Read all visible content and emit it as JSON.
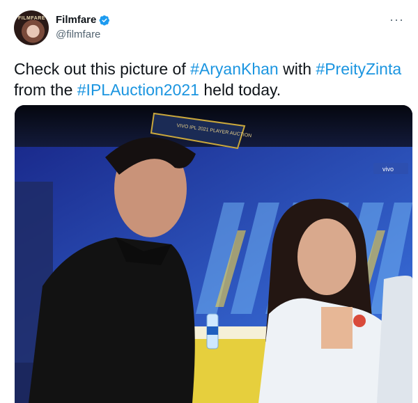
{
  "account": {
    "display_name": "Filmfare",
    "handle": "@filmfare",
    "avatar_text": "FILMFARE",
    "verified": true
  },
  "menu": {
    "more_label": "···"
  },
  "tweet": {
    "segments": [
      {
        "text": "Check out this picture of ",
        "type": "text"
      },
      {
        "text": "#AryanKhan",
        "type": "hashtag"
      },
      {
        "text": " with ",
        "type": "text"
      },
      {
        "text": "#PreityZinta",
        "type": "hashtag"
      },
      {
        "text": " from the ",
        "type": "text"
      },
      {
        "text": "#IPLAuction2021",
        "type": "hashtag"
      },
      {
        "text": " held today.",
        "type": "text"
      }
    ]
  },
  "media": {
    "type": "photo",
    "banner_text": "VIVO IPL 2021 PLAYER AUCTION",
    "sponsor_text": "vivo"
  },
  "colors": {
    "hashtag": "#1b95e0",
    "verified": "#1d9bf0",
    "secondary_text": "#536471",
    "stage_blue": "#2f5bd6"
  },
  "icons": [
    "verified-badge-icon",
    "more-options-icon"
  ]
}
